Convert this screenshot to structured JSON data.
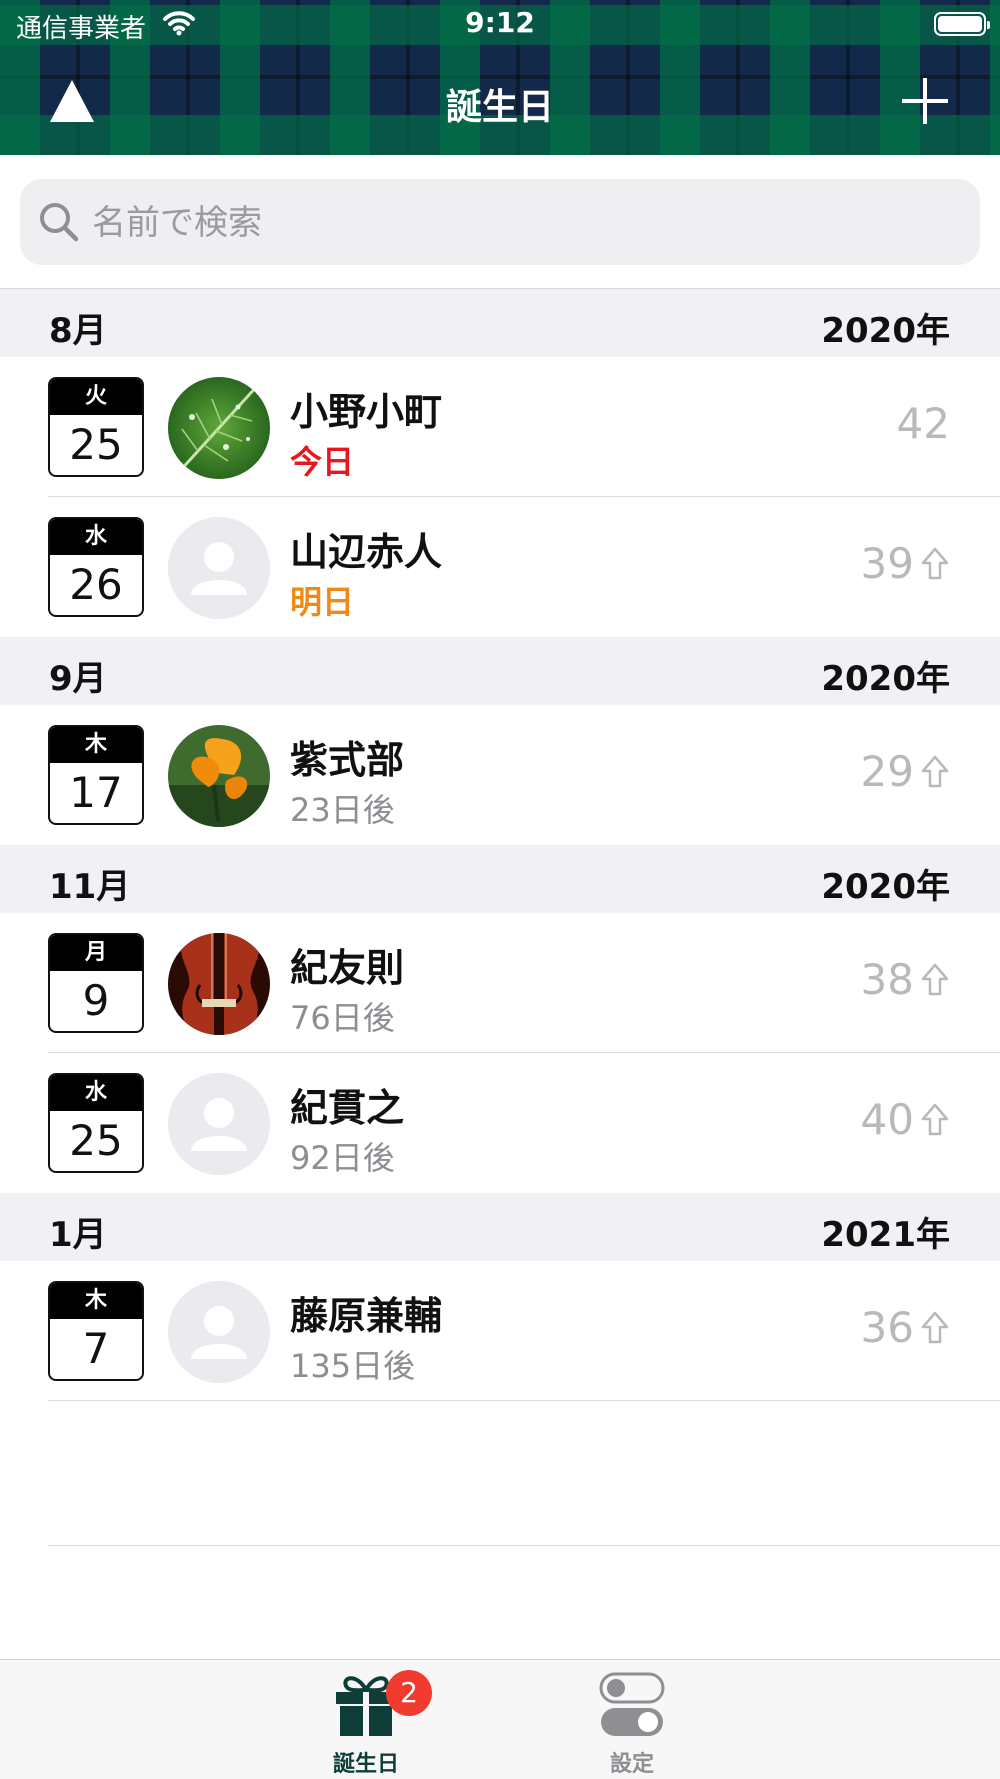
{
  "status_bar": {
    "carrier": "通信事業者",
    "time": "9:12"
  },
  "nav": {
    "title": "誕生日"
  },
  "search": {
    "placeholder": "名前で検索"
  },
  "sections": [
    {
      "month": "8月",
      "year": "2020年",
      "rows": [
        {
          "weekday": "火",
          "day": "25",
          "name": "小野小町",
          "sub": "今日",
          "sub_style": "today",
          "age": "42",
          "arrow": false,
          "avatar": "leaf"
        },
        {
          "weekday": "水",
          "day": "26",
          "name": "山辺赤人",
          "sub": "明日",
          "sub_style": "tomorrow",
          "age": "39",
          "arrow": true,
          "avatar": "placeholder"
        }
      ]
    },
    {
      "month": "9月",
      "year": "2020年",
      "rows": [
        {
          "weekday": "木",
          "day": "17",
          "name": "紫式部",
          "sub": "23日後",
          "sub_style": "normal",
          "age": "29",
          "arrow": true,
          "avatar": "flower"
        }
      ]
    },
    {
      "month": "11月",
      "year": "2020年",
      "rows": [
        {
          "weekday": "月",
          "day": "9",
          "name": "紀友則",
          "sub": "76日後",
          "sub_style": "normal",
          "age": "38",
          "arrow": true,
          "avatar": "violin"
        },
        {
          "weekday": "水",
          "day": "25",
          "name": "紀貫之",
          "sub": "92日後",
          "sub_style": "normal",
          "age": "40",
          "arrow": true,
          "avatar": "placeholder"
        }
      ]
    },
    {
      "month": "1月",
      "year": "2021年",
      "rows": [
        {
          "weekday": "木",
          "day": "7",
          "name": "藤原兼輔",
          "sub": "135日後",
          "sub_style": "normal",
          "age": "36",
          "arrow": true,
          "avatar": "placeholder"
        }
      ]
    }
  ],
  "tabbar": {
    "tabs": [
      {
        "label": "誕生日",
        "icon": "gift-icon",
        "badge": "2",
        "selected": true
      },
      {
        "label": "設定",
        "icon": "toggle-icon",
        "selected": false
      }
    ]
  },
  "colors": {
    "today": "#e8171d",
    "tomorrow": "#f08a17",
    "badge": "#f23b30",
    "tab_selected": "#0f3d37"
  }
}
